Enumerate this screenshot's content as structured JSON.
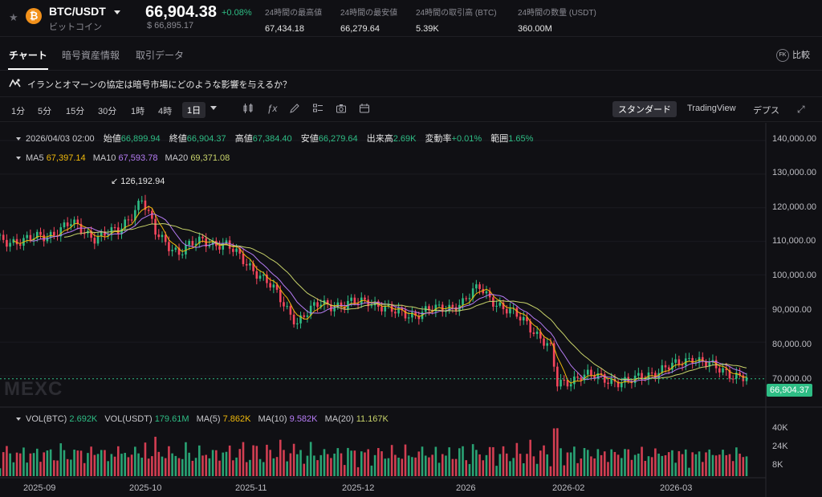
{
  "header": {
    "pair": "BTC/USDT",
    "coin_name": "ビットコイン",
    "coin_symbol": "₿",
    "last_price": "66,904.38",
    "change_pct": "+0.08%",
    "fiat_price": "$ 66,895.17",
    "stats": [
      {
        "label": "24時間の最高値",
        "value": "67,434.18"
      },
      {
        "label": "24時間の最安値",
        "value": "66,279.64"
      },
      {
        "label": "24時間の取引高 (BTC)",
        "value": "5.39K"
      },
      {
        "label": "24時間の数量 (USDT)",
        "value": "360.00M"
      }
    ]
  },
  "tabs": [
    "チャート",
    "暗号資産情報",
    "取引データ"
  ],
  "compare": {
    "icon_text": "FK",
    "label": "比較"
  },
  "news": "イランとオマーンの協定は暗号市場にどのような影響を与えるか？",
  "toolbar": {
    "timeframes": [
      "1分",
      "5分",
      "15分",
      "30分",
      "1時",
      "4時",
      "1日"
    ],
    "active_timeframe": "1日",
    "icons": [
      "candles-icon",
      "indicator-icon",
      "draw-icon",
      "template-icon",
      "camera-icon",
      "calendar-icon"
    ],
    "views": [
      "スタンダード",
      "TradingView",
      "デプス"
    ],
    "active_view": "スタンダード"
  },
  "ohlc": {
    "date": "2026/04/03 02:00",
    "open_label": "始値",
    "open": "66,899.94",
    "close_label": "終値",
    "close": "66,904.37",
    "high_label": "高値",
    "high": "67,384.40",
    "low_label": "安値",
    "low": "66,279.64",
    "vol_label": "出来高",
    "vol": "2.69K",
    "chg_label": "変動率",
    "chg": "+0.01%",
    "range_label": "範囲",
    "range": "1.65%"
  },
  "ma": {
    "ma5_label": "MA5",
    "ma5": "67,397.14",
    "ma10_label": "MA10",
    "ma10": "67,593.78",
    "ma20_label": "MA20",
    "ma20": "69,371.08"
  },
  "vol": {
    "btc_label": "VOL(BTC)",
    "btc": "2.692K",
    "usdt_label": "VOL(USDT)",
    "usdt": "179.61M",
    "ma5_label": "MA(5)",
    "ma5": "7.862K",
    "ma10_label": "MA(10)",
    "ma10": "9.582K",
    "ma20_label": "MA(20)",
    "ma20": "11.167K"
  },
  "watermark": "MEXC",
  "peak_label": "126,192.94",
  "last_price_badge": "66,904.37",
  "colors": {
    "up": "#2ebd85",
    "down": "#f6465d",
    "ma5": "#f0b90b",
    "ma10": "#b67cf5",
    "ma20": "#c8d36a"
  },
  "chart_data": {
    "type": "candlestick",
    "y_ticks": [
      "140,000.00",
      "130,000.00",
      "120,000.00",
      "110,000.00",
      "100,000.00",
      "90,000.00",
      "80,000.00",
      "70,000.00"
    ],
    "volume_ticks": [
      "40K",
      "24K",
      "8K"
    ],
    "x_ticks": [
      "2025-09",
      "2025-10",
      "2025-11",
      "2025-12",
      "2026",
      "2026-02",
      "2026-03"
    ],
    "ylim": [
      62000,
      143000
    ],
    "close_path": [
      [
        "2025-08-25",
        111000
      ],
      [
        "2025-09-01",
        110500
      ],
      [
        "2025-09-08",
        112500
      ],
      [
        "2025-09-15",
        116000
      ],
      [
        "2025-09-22",
        112000
      ],
      [
        "2025-09-29",
        113500
      ],
      [
        "2025-10-06",
        124000
      ],
      [
        "2025-10-10",
        113000
      ],
      [
        "2025-10-17",
        107000
      ],
      [
        "2025-10-24",
        111000
      ],
      [
        "2025-10-31",
        109000
      ],
      [
        "2025-11-07",
        103000
      ],
      [
        "2025-11-14",
        95000
      ],
      [
        "2025-11-21",
        85000
      ],
      [
        "2025-11-28",
        91000
      ],
      [
        "2025-12-05",
        90000
      ],
      [
        "2025-12-12",
        92000
      ],
      [
        "2025-12-19",
        88000
      ],
      [
        "2025-12-26",
        87500
      ],
      [
        "2026-01-02",
        89000
      ],
      [
        "2026-01-09",
        91000
      ],
      [
        "2026-01-14",
        96000
      ],
      [
        "2026-01-21",
        89000
      ],
      [
        "2026-01-28",
        85000
      ],
      [
        "2026-02-04",
        76000
      ],
      [
        "2026-02-06",
        65000
      ],
      [
        "2026-02-13",
        68000
      ],
      [
        "2026-02-20",
        67000
      ],
      [
        "2026-02-27",
        65500
      ],
      [
        "2026-03-06",
        69000
      ],
      [
        "2026-03-13",
        71000
      ],
      [
        "2026-03-18",
        74000
      ],
      [
        "2026-03-25",
        70000
      ],
      [
        "2026-04-01",
        68000
      ],
      [
        "2026-04-03",
        66904
      ]
    ]
  }
}
